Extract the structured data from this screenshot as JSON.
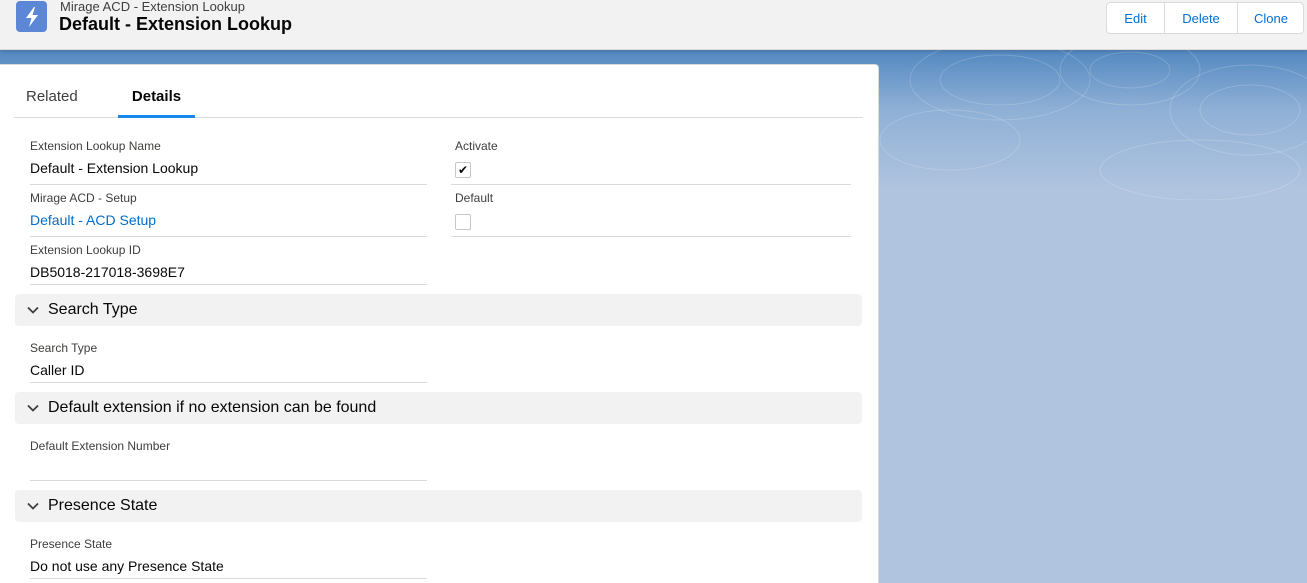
{
  "header": {
    "object_label": "Mirage ACD - Extension Lookup",
    "record_title": "Default - Extension Lookup",
    "buttons": {
      "edit": "Edit",
      "delete": "Delete",
      "clone": "Clone"
    }
  },
  "tabs": {
    "related": "Related",
    "details": "Details",
    "active": "Details"
  },
  "fields": {
    "name": {
      "label": "Extension Lookup Name",
      "value": "Default - Extension Lookup"
    },
    "activate": {
      "label": "Activate",
      "checked": true
    },
    "setup": {
      "label": "Mirage ACD - Setup",
      "value": "Default - ACD Setup"
    },
    "default": {
      "label": "Default",
      "checked": false
    },
    "lookup_id": {
      "label": "Extension Lookup ID",
      "value": "DB5018-217018-3698E7"
    }
  },
  "sections": [
    {
      "title": "Search Type",
      "field": {
        "label": "Search Type",
        "value": "Caller ID"
      }
    },
    {
      "title": "Default extension if no extension can be found",
      "field": {
        "label": "Default Extension Number",
        "value": ""
      }
    },
    {
      "title": "Presence State",
      "field": {
        "label": "Presence State",
        "value": "Do not use any Presence State"
      }
    }
  ],
  "icons": {
    "object": "lightning-bolt-icon",
    "section": "chevron-down-icon",
    "check": "checkmark-icon"
  },
  "colors": {
    "brand": "#5c87d7",
    "link": "#006dcc",
    "tab_accent": "#1589ee",
    "button_text": "#0070d2"
  }
}
